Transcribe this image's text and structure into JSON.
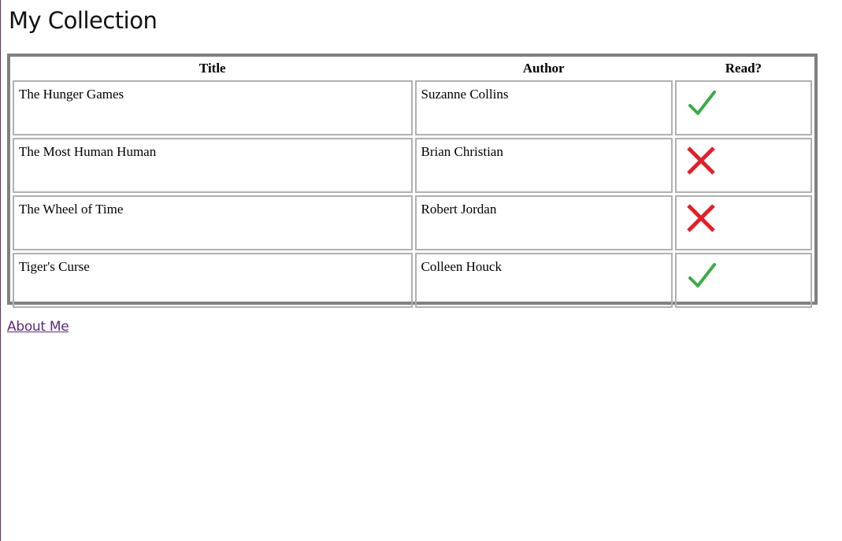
{
  "page": {
    "title": "My Collection"
  },
  "table": {
    "headers": [
      "Title",
      "Author",
      "Read?"
    ],
    "rows": [
      {
        "title": "The Hunger Games",
        "author": "Suzanne Collins",
        "read": true,
        "read_icon": "check-icon"
      },
      {
        "title": "The Most Human Human",
        "author": "Brian Christian",
        "read": false,
        "read_icon": "cross-icon"
      },
      {
        "title": "The Wheel of Time",
        "author": "Robert Jordan",
        "read": false,
        "read_icon": "cross-icon"
      },
      {
        "title": "Tiger's Curse",
        "author": "Colleen Houck",
        "read": true,
        "read_icon": "check-icon"
      }
    ]
  },
  "footer": {
    "about_link": "About Me"
  },
  "colors": {
    "check": "#3daa47",
    "cross": "#e0202a",
    "link": "#5b2a7a",
    "table_border": "#808080"
  }
}
